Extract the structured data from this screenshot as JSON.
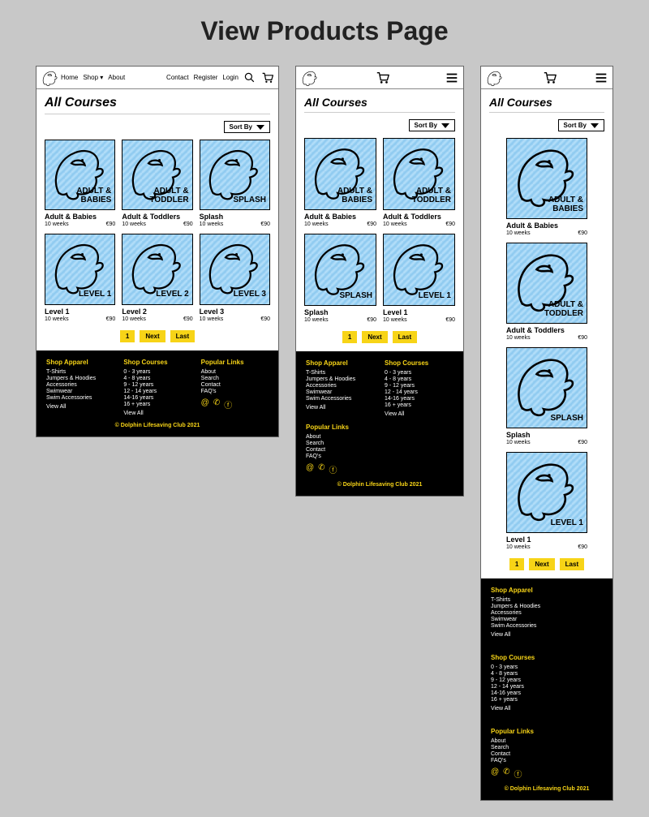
{
  "title": "View Products Page",
  "nav": {
    "home": "Home",
    "shop": "Shop",
    "about": "About",
    "contact": "Contact",
    "register": "Register",
    "login": "Login"
  },
  "heading": "All Courses",
  "sortBy": "Sort By",
  "products": {
    "adultBabies": {
      "thumbLine1": "ADULT &",
      "thumbLine2": "BABIES",
      "title": "Adult & Babies",
      "duration": "10 weeks",
      "price": "€90"
    },
    "adultToddlers": {
      "thumbLine1": "ADULT &",
      "thumbLine2": "TODDLER",
      "title": "Adult & Toddlers",
      "duration": "10 weeks",
      "price": "€90"
    },
    "splash": {
      "thumbLine1": "",
      "thumbLine2": "SPLASH",
      "title": "Splash",
      "duration": "10 weeks",
      "price": "€90"
    },
    "level1": {
      "thumbLine1": "",
      "thumbLine2": "LEVEL 1",
      "title": "Level 1",
      "duration": "10 weeks",
      "price": "€90"
    },
    "level2": {
      "thumbLine1": "",
      "thumbLine2": "LEVEL 2",
      "title": "Level 2",
      "duration": "10 weeks",
      "price": "€90"
    },
    "level3": {
      "thumbLine1": "",
      "thumbLine2": "LEVEL 3",
      "title": "Level 3",
      "duration": "10 weeks",
      "price": "€90"
    }
  },
  "pager": {
    "p1": "1",
    "next": "Next",
    "last": "Last"
  },
  "footer": {
    "apparel": {
      "title": "Shop Apparel",
      "i0": "T-Shirts",
      "i1": "Jumpers & Hoodies",
      "i2": "Accessories",
      "i3": "Swimwear",
      "i4": "Swim Accessories",
      "viewAll": "View All"
    },
    "courses": {
      "title": "Shop Courses",
      "i0": "0 - 3 years",
      "i1": "4 - 8 years",
      "i2": "9 - 12 years",
      "i3": "12 - 14 years",
      "i4": "14-16 years",
      "i5": "16 + years",
      "viewAll": "View All"
    },
    "popular": {
      "title": "Popular Links",
      "i0": "About",
      "i1": "Search",
      "i2": "Contact",
      "i3": "FAQ's"
    },
    "copyright": "© Dolphin Lifesaving Club 2021"
  }
}
